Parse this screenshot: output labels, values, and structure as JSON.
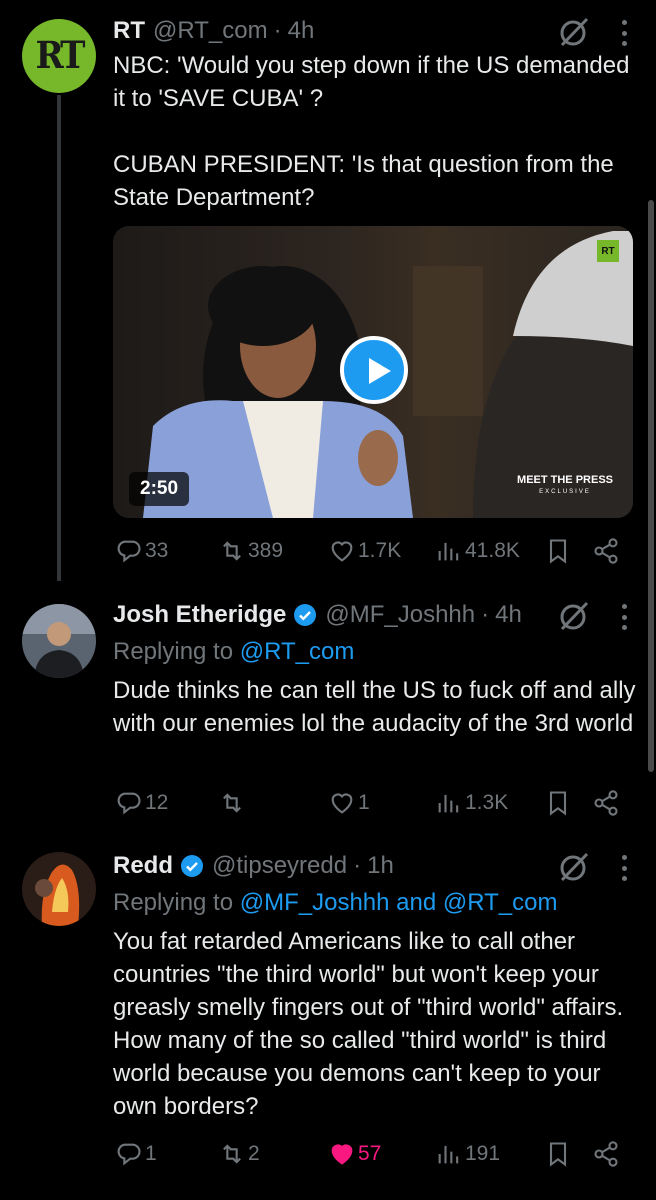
{
  "tweets": [
    {
      "name": "RT",
      "handle": "@RT_com",
      "time": "4h",
      "avatar_text": "RT",
      "text": "NBC: 'Would you step down if the US demanded it to 'SAVE CUBA' ?\n\nCUBAN PRESIDENT: 'Is that question from the State Department?",
      "video": {
        "duration": "2:50",
        "channel_badge": "RT",
        "watermark": "MEET THE PRESS",
        "watermark_sub": "EXCLUSIVE"
      },
      "stats": {
        "replies": "33",
        "reposts": "389",
        "likes": "1.7K",
        "views": "41.8K"
      }
    },
    {
      "name": "Josh Etheridge",
      "handle": "@MF_Joshhh",
      "time": "4h",
      "reply_prefix": "Replying to ",
      "reply_targets": "@RT_com",
      "text": "Dude thinks he can tell the US to fuck off and ally with our enemies lol the audacity of the 3rd world",
      "stats": {
        "replies": "12",
        "reposts": "",
        "likes": "1",
        "views": "1.3K"
      }
    },
    {
      "name": "Redd",
      "handle": "@tipseyredd",
      "time": "1h",
      "reply_prefix": "Replying to ",
      "reply_targets": "@MF_Joshhh and @RT_com",
      "text": "You fat retarded Americans like to call other countries \"the third world\" but won't keep your greasly smelly fingers out of \"third world\" affairs. How many of the so called \"third world\" is third world because you demons can't keep to your own borders?",
      "stats": {
        "replies": "1",
        "reposts": "2",
        "likes": "57",
        "views": "191",
        "liked": true
      }
    }
  ],
  "colors": {
    "accent": "#1d9bf0",
    "like_active": "#f91880",
    "muted": "#71767b",
    "rt_green": "#77b82b"
  }
}
